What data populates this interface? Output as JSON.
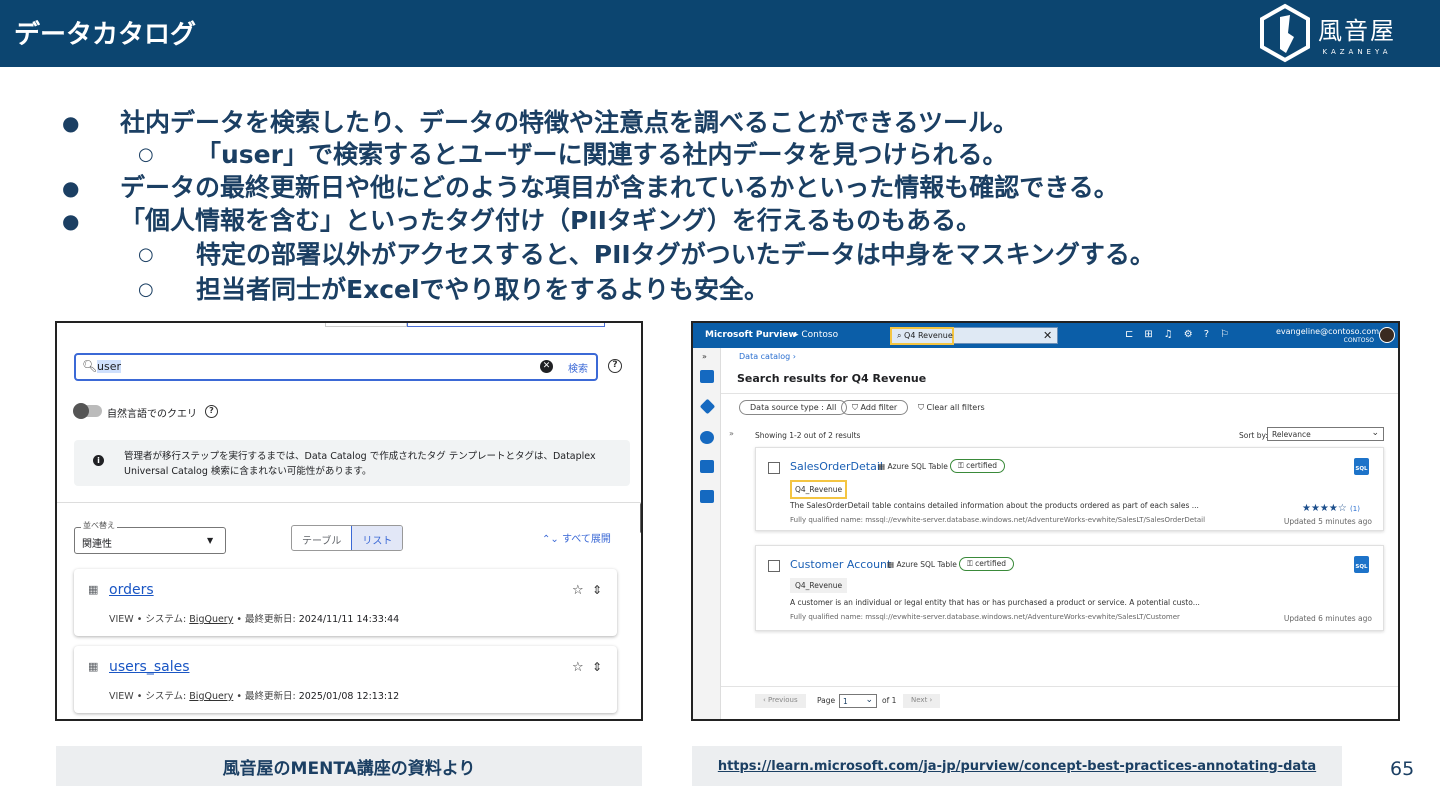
{
  "header": {
    "title": "データカタログ",
    "logo_kanji": "風音屋",
    "logo_roman": "KAZANEYA"
  },
  "bullets": [
    {
      "level": 1,
      "text": "社内データを検索したり、データの特徴や注意点を調べることができるツール。"
    },
    {
      "level": 2,
      "text": "「user」で検索するとユーザーに関連する社内データを見つけられる。"
    },
    {
      "level": 1,
      "text": "データの最終更新日や他にどのような項目が含まれているかといった情報も確認できる。"
    },
    {
      "level": 1,
      "text": "「個人情報を含む」といったタグ付け（PIIタギング）を行えるものもある。"
    },
    {
      "level": 2,
      "text": "特定の部署以外がアクセスすると、PIIタグがついたデータは中身をマスキングする。"
    },
    {
      "level": 2,
      "text": "担当者同士がExcelでやり取りをするよりも安全。"
    }
  ],
  "bullet_markers": {
    "l1": "●",
    "l2": "○"
  },
  "gcp": {
    "search_value": "user",
    "search_button": "検索",
    "nl_query_label": "自然言語でのクエリ",
    "info_text": "管理者が移行ステップを実行するまでは、Data Catalog で作成されたタグ テンプレートとタグは、Dataplex Universal Catalog 検索に含まれない可能性があります。",
    "sort_label": "並べ替え",
    "sort_value": "関連性",
    "view_table": "テーブル",
    "view_list": "リスト",
    "expand_all": "すべて展開",
    "results": [
      {
        "name": "orders",
        "meta_prefix": "VIEW • システム: ",
        "system": "BigQuery",
        "meta_mid": " • 最終更新日: ",
        "updated": "2024/11/11 14:33:44"
      },
      {
        "name": "users_sales",
        "meta_prefix": "VIEW • システム: ",
        "system": "BigQuery",
        "meta_mid": " • 最終更新日: ",
        "updated": "2025/01/08 12:13:12"
      }
    ]
  },
  "purview": {
    "brand": "Microsoft Purview",
    "crumb": "▸  Contoso",
    "search_value": "Q4 Revenue",
    "user_email": "evangeline@contoso.com",
    "user_org": "CONTOSO",
    "breadcrumb": "Data catalog  ›",
    "title": "Search results for Q4 Revenue",
    "filter_source": "Data source type : All",
    "add_filter": "Add filter",
    "clear_filters": "Clear all filters",
    "showing": "Showing 1-2 out of 2 results",
    "sort_by_label": "Sort by:",
    "sort_by_value": "Relevance",
    "results": [
      {
        "name": "SalesOrderDetail",
        "type": "Azure SQL Table",
        "badge": "certified",
        "tag": "Q4_Revenue",
        "desc": "The SalesOrderDetail table contains detailed information about the products ordered as part of each sales ...",
        "fqn": "Fully qualified name: mssql://evwhite-server.database.windows.net/AdventureWorks-evwhite/SalesLT/SalesOrderDetail",
        "rating": "★★★★☆",
        "rating_count": "(1)",
        "updated": "Updated 5 minutes ago"
      },
      {
        "name": "Customer Account",
        "type": "Azure SQL Table",
        "badge": "certified",
        "tag": "Q4_Revenue",
        "desc": "A customer is an individual or legal entity that has or has purchased a product or service. A potential custo...",
        "fqn": "Fully qualified name: mssql://evwhite-server.database.windows.net/AdventureWorks-evwhite/SalesLT/Customer",
        "updated": "Updated 6 minutes ago"
      }
    ],
    "prev": "‹ Previous",
    "page_label": "Page",
    "page_value": "1",
    "of_label": "of 1",
    "next": "Next ›"
  },
  "captions": {
    "left": "風音屋のMENTA講座の資料より",
    "right": "https://learn.microsoft.com/ja-jp/purview/concept-best-practices-annotating-data"
  },
  "page_number": "65",
  "colors": {
    "header_bg": "#0c4570",
    "text": "#1b3f63",
    "purview_bar": "#0b5ea8",
    "highlight": "#f4c542"
  }
}
